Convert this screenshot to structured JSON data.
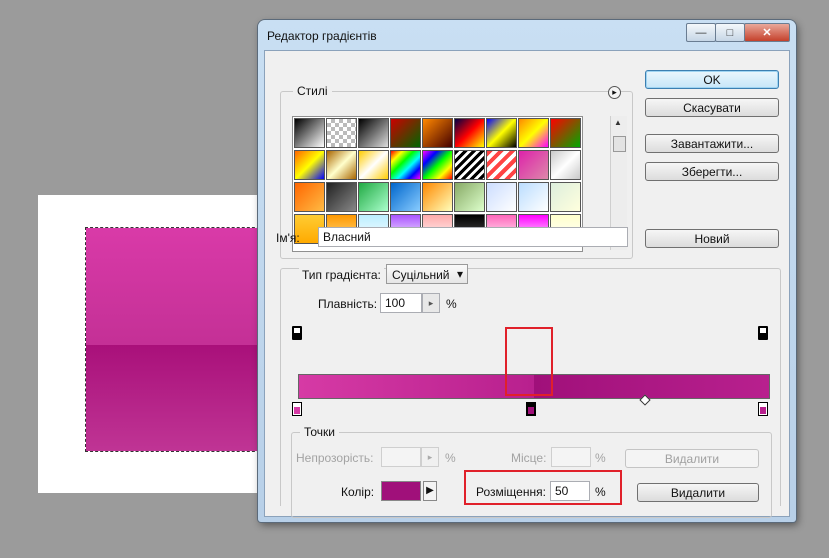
{
  "window": {
    "title": "Редактор градієнтів",
    "minimize_glyph": "—",
    "maximize_glyph": "□",
    "close_glyph": "✕"
  },
  "presets": {
    "legend": "Стилі",
    "menu_glyph": "▸",
    "swatches": [
      [
        "linear-gradient(135deg,#000,#fff)",
        "repeating-conic-gradient(#bbb 0 25%,#fff 0 50%) 0 0/8px 8px",
        "linear-gradient(135deg,#000,#ddd)",
        "linear-gradient(135deg,#c00,#060)",
        "linear-gradient(135deg,#f80,#400)",
        "linear-gradient(135deg,#004,#f00,#ff0)",
        "linear-gradient(135deg,#00f,#ff0,#000)",
        "linear-gradient(135deg,#f80,#ff0,#f0f)",
        "linear-gradient(135deg,#f00,#0a0)"
      ],
      [
        "linear-gradient(135deg,#f60,#ff0,#00f)",
        "linear-gradient(135deg,#a60,#ffc,#a60)",
        "linear-gradient(135deg,#fc0,#fff,#fc0)",
        "linear-gradient(135deg,#f00,#ff0,#0f0,#0ff,#00f,#f0f)",
        "linear-gradient(135deg,#f0f,#00f,#0f0,#ff0,#f00)",
        "repeating-linear-gradient(135deg,#000 0 3px,#fff 3px 6px)",
        "repeating-linear-gradient(135deg,#f44 0 4px,#fff 4px 8px)",
        "linear-gradient(135deg,#d2a,#d8a)",
        "linear-gradient(135deg,#c8c8c8,#fff,#c8c8c8)"
      ],
      [
        "linear-gradient(135deg,#f60,#fb4)",
        "linear-gradient(135deg,#222,#888)",
        "linear-gradient(135deg,#2a4,#afc)",
        "linear-gradient(135deg,#06c,#8cf)",
        "linear-gradient(135deg,#f80,#ffb)",
        "linear-gradient(135deg,#8a6,#dfc)",
        "linear-gradient(135deg,#cdf,#fff)",
        "linear-gradient(135deg,#bdf,#fff)",
        "linear-gradient(135deg,#ded,#ffd)"
      ],
      [
        "linear-gradient(#fc3,#fa0)",
        "linear-gradient(#f90,#fd8)",
        "linear-gradient(#bef,#fff)",
        "linear-gradient(#a5f,#fff)",
        "linear-gradient(#faa,#fff)",
        "linear-gradient(#000,#555)",
        "linear-gradient(#f6b,#fff)",
        "linear-gradient(#f0f,#fff)",
        "linear-gradient(#ffc,#fff)"
      ]
    ],
    "scroll_up": "▲",
    "scroll_down": "▼"
  },
  "buttons": {
    "ok": "OK",
    "cancel": "Скасувати",
    "load": "Завантажити...",
    "save": "Зберегти...",
    "new": "Новий"
  },
  "name_field": {
    "label": "Ім'я:",
    "value": "Власний"
  },
  "gradient_type": {
    "label": "Тип градієнта:",
    "value": "Суцільний",
    "arrow": "▾"
  },
  "smoothness": {
    "label": "Плавність:",
    "value": "100",
    "unit": "%",
    "arrow": "▸"
  },
  "colors": {
    "gradient_left": "#d63aa5",
    "gradient_mid": "#b8208e",
    "gradient_right": "#a0107a",
    "selected_color": "#a0107a",
    "highlight": "#e0202a"
  },
  "stops": {
    "legend": "Точки",
    "opacity_label": "Непрозорість:",
    "opacity_unit": "%",
    "opacity_arrow": "▸",
    "location_label_top": "Місце:",
    "location_unit_top": "%",
    "delete_top": "Видалити",
    "color_label": "Колір:",
    "color_arrow": "▶",
    "location_label": "Розміщення:",
    "location_value": "50",
    "location_unit": "%",
    "delete_bottom": "Видалити"
  }
}
